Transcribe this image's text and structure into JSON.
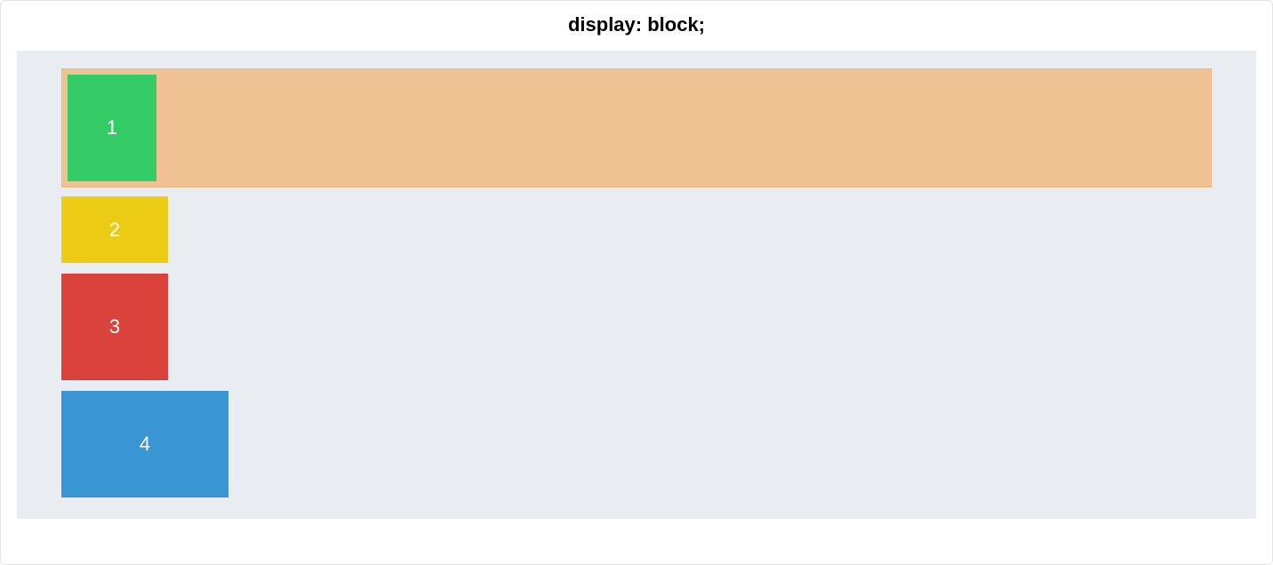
{
  "title": "display: block;",
  "boxes": {
    "b1": {
      "label": "1",
      "color": "#33cc66"
    },
    "b2": {
      "label": "2",
      "color": "#eccb15"
    },
    "b3": {
      "label": "3",
      "color": "#d9433c"
    },
    "b4": {
      "label": "4",
      "color": "#3996d2"
    }
  },
  "highlight_color": "#f0c293",
  "panel_bg": "#e9edf1"
}
